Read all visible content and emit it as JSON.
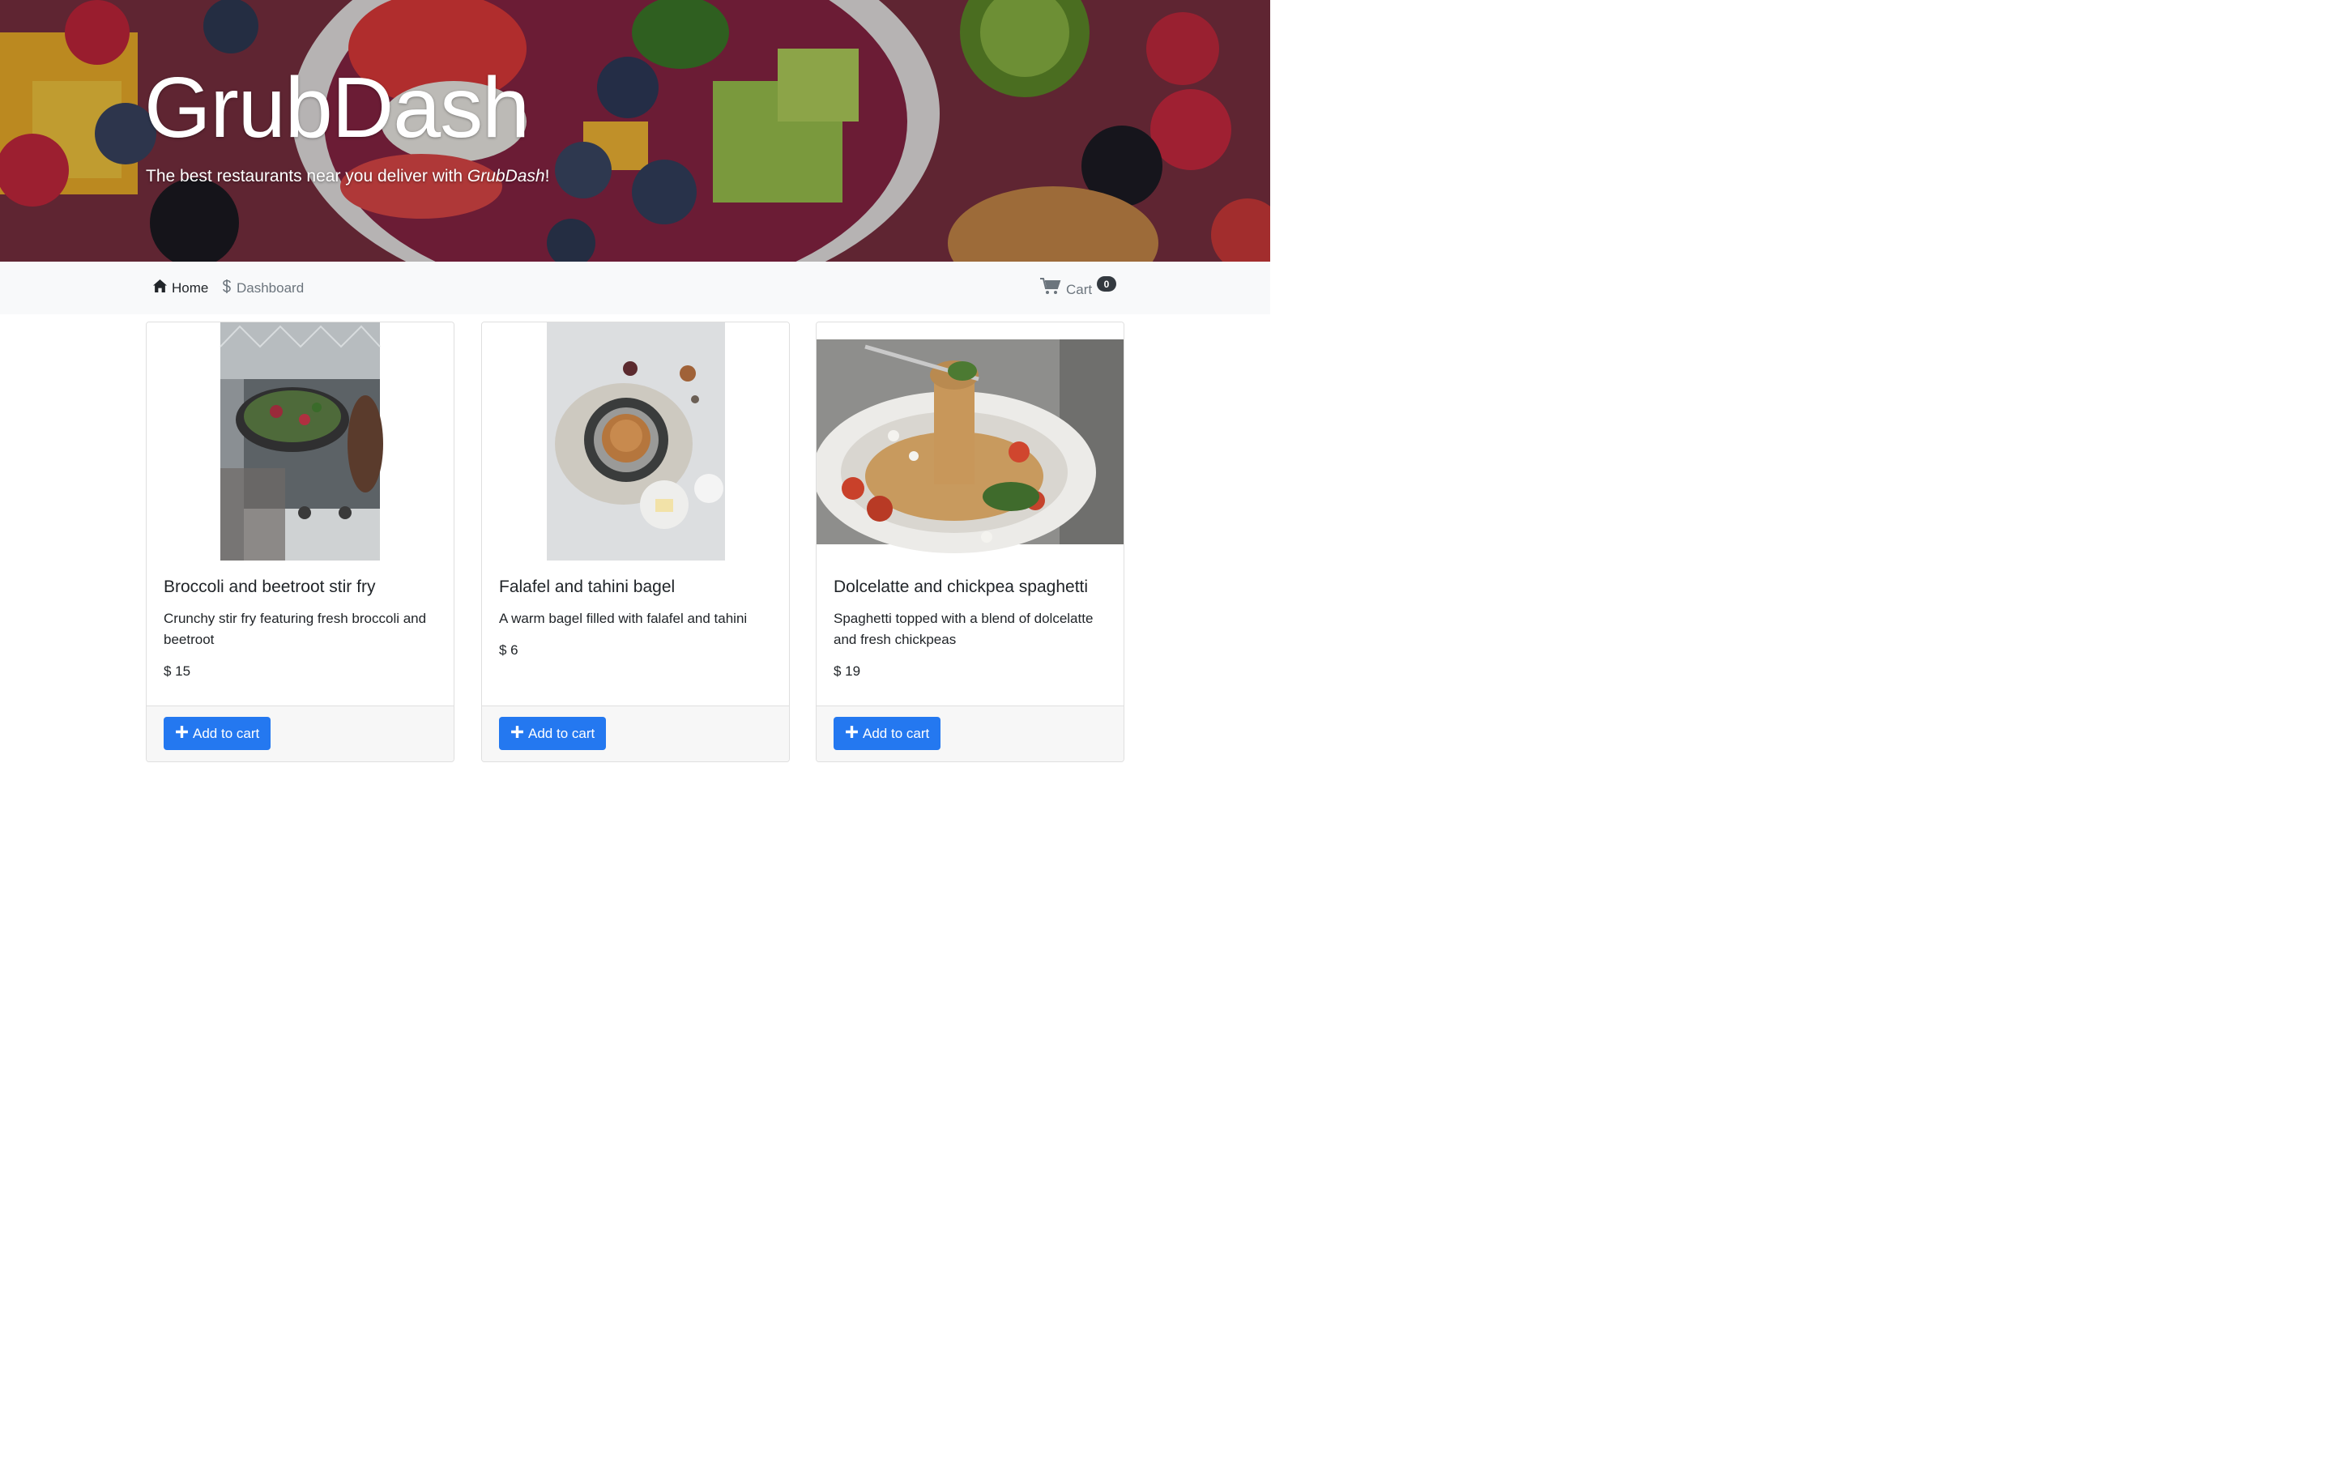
{
  "hero": {
    "title": "GrubDash",
    "tagline_prefix": "The best restaurants near you deliver with ",
    "tagline_brand": "GrubDash",
    "tagline_suffix": "!"
  },
  "nav": {
    "home_label": "Home",
    "home_icon": "house-icon",
    "dashboard_label": "Dashboard",
    "dashboard_icon": "dollar-icon",
    "cart_label": "Cart",
    "cart_icon": "cart-icon",
    "cart_count": "0"
  },
  "cards": [
    {
      "title": "Broccoli and beetroot stir fry",
      "description": "Crunchy stir fry featuring fresh broccoli and beetroot",
      "price": "$ 15",
      "button_label": "Add to cart",
      "image": "stir-fry-pan-photo"
    },
    {
      "title": "Falafel and tahini bagel",
      "description": "A warm bagel filled with falafel and tahini",
      "price": "$ 6",
      "button_label": "Add to cart",
      "image": "bagel-plate-photo"
    },
    {
      "title": "Dolcelatte and chickpea spaghetti",
      "description": "Spaghetti topped with a blend of dolcelatte and fresh chickpeas",
      "price": "$ 19",
      "button_label": "Add to cart",
      "image": "spaghetti-plate-photo"
    }
  ],
  "colors": {
    "primary": "#2478f0",
    "navbar_bg": "#f8f9fa",
    "badge_bg": "#343a40",
    "muted": "#6c757d"
  }
}
